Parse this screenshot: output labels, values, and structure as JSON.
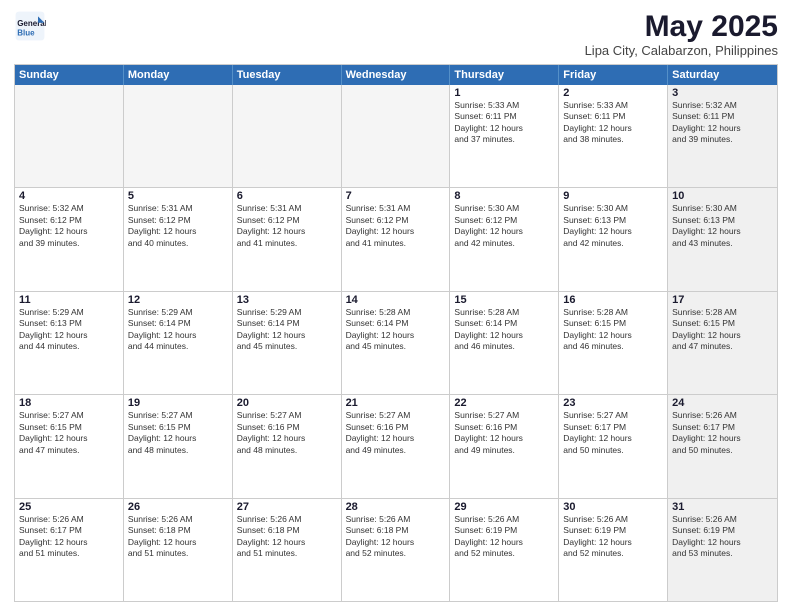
{
  "logo": {
    "line1": "General",
    "line2": "Blue"
  },
  "title": "May 2025",
  "subtitle": "Lipa City, Calabarzon, Philippines",
  "days": [
    "Sunday",
    "Monday",
    "Tuesday",
    "Wednesday",
    "Thursday",
    "Friday",
    "Saturday"
  ],
  "weeks": [
    [
      {
        "day": "",
        "info": "",
        "empty": true
      },
      {
        "day": "",
        "info": "",
        "empty": true
      },
      {
        "day": "",
        "info": "",
        "empty": true
      },
      {
        "day": "",
        "info": "",
        "empty": true
      },
      {
        "day": "1",
        "info": "Sunrise: 5:33 AM\nSunset: 6:11 PM\nDaylight: 12 hours\nand 37 minutes.",
        "empty": false
      },
      {
        "day": "2",
        "info": "Sunrise: 5:33 AM\nSunset: 6:11 PM\nDaylight: 12 hours\nand 38 minutes.",
        "empty": false
      },
      {
        "day": "3",
        "info": "Sunrise: 5:32 AM\nSunset: 6:11 PM\nDaylight: 12 hours\nand 39 minutes.",
        "empty": false,
        "shaded": true
      }
    ],
    [
      {
        "day": "4",
        "info": "Sunrise: 5:32 AM\nSunset: 6:12 PM\nDaylight: 12 hours\nand 39 minutes.",
        "empty": false
      },
      {
        "day": "5",
        "info": "Sunrise: 5:31 AM\nSunset: 6:12 PM\nDaylight: 12 hours\nand 40 minutes.",
        "empty": false
      },
      {
        "day": "6",
        "info": "Sunrise: 5:31 AM\nSunset: 6:12 PM\nDaylight: 12 hours\nand 41 minutes.",
        "empty": false
      },
      {
        "day": "7",
        "info": "Sunrise: 5:31 AM\nSunset: 6:12 PM\nDaylight: 12 hours\nand 41 minutes.",
        "empty": false
      },
      {
        "day": "8",
        "info": "Sunrise: 5:30 AM\nSunset: 6:12 PM\nDaylight: 12 hours\nand 42 minutes.",
        "empty": false
      },
      {
        "day": "9",
        "info": "Sunrise: 5:30 AM\nSunset: 6:13 PM\nDaylight: 12 hours\nand 42 minutes.",
        "empty": false
      },
      {
        "day": "10",
        "info": "Sunrise: 5:30 AM\nSunset: 6:13 PM\nDaylight: 12 hours\nand 43 minutes.",
        "empty": false,
        "shaded": true
      }
    ],
    [
      {
        "day": "11",
        "info": "Sunrise: 5:29 AM\nSunset: 6:13 PM\nDaylight: 12 hours\nand 44 minutes.",
        "empty": false
      },
      {
        "day": "12",
        "info": "Sunrise: 5:29 AM\nSunset: 6:14 PM\nDaylight: 12 hours\nand 44 minutes.",
        "empty": false
      },
      {
        "day": "13",
        "info": "Sunrise: 5:29 AM\nSunset: 6:14 PM\nDaylight: 12 hours\nand 45 minutes.",
        "empty": false
      },
      {
        "day": "14",
        "info": "Sunrise: 5:28 AM\nSunset: 6:14 PM\nDaylight: 12 hours\nand 45 minutes.",
        "empty": false
      },
      {
        "day": "15",
        "info": "Sunrise: 5:28 AM\nSunset: 6:14 PM\nDaylight: 12 hours\nand 46 minutes.",
        "empty": false
      },
      {
        "day": "16",
        "info": "Sunrise: 5:28 AM\nSunset: 6:15 PM\nDaylight: 12 hours\nand 46 minutes.",
        "empty": false
      },
      {
        "day": "17",
        "info": "Sunrise: 5:28 AM\nSunset: 6:15 PM\nDaylight: 12 hours\nand 47 minutes.",
        "empty": false,
        "shaded": true
      }
    ],
    [
      {
        "day": "18",
        "info": "Sunrise: 5:27 AM\nSunset: 6:15 PM\nDaylight: 12 hours\nand 47 minutes.",
        "empty": false
      },
      {
        "day": "19",
        "info": "Sunrise: 5:27 AM\nSunset: 6:15 PM\nDaylight: 12 hours\nand 48 minutes.",
        "empty": false
      },
      {
        "day": "20",
        "info": "Sunrise: 5:27 AM\nSunset: 6:16 PM\nDaylight: 12 hours\nand 48 minutes.",
        "empty": false
      },
      {
        "day": "21",
        "info": "Sunrise: 5:27 AM\nSunset: 6:16 PM\nDaylight: 12 hours\nand 49 minutes.",
        "empty": false
      },
      {
        "day": "22",
        "info": "Sunrise: 5:27 AM\nSunset: 6:16 PM\nDaylight: 12 hours\nand 49 minutes.",
        "empty": false
      },
      {
        "day": "23",
        "info": "Sunrise: 5:27 AM\nSunset: 6:17 PM\nDaylight: 12 hours\nand 50 minutes.",
        "empty": false
      },
      {
        "day": "24",
        "info": "Sunrise: 5:26 AM\nSunset: 6:17 PM\nDaylight: 12 hours\nand 50 minutes.",
        "empty": false,
        "shaded": true
      }
    ],
    [
      {
        "day": "25",
        "info": "Sunrise: 5:26 AM\nSunset: 6:17 PM\nDaylight: 12 hours\nand 51 minutes.",
        "empty": false
      },
      {
        "day": "26",
        "info": "Sunrise: 5:26 AM\nSunset: 6:18 PM\nDaylight: 12 hours\nand 51 minutes.",
        "empty": false
      },
      {
        "day": "27",
        "info": "Sunrise: 5:26 AM\nSunset: 6:18 PM\nDaylight: 12 hours\nand 51 minutes.",
        "empty": false
      },
      {
        "day": "28",
        "info": "Sunrise: 5:26 AM\nSunset: 6:18 PM\nDaylight: 12 hours\nand 52 minutes.",
        "empty": false
      },
      {
        "day": "29",
        "info": "Sunrise: 5:26 AM\nSunset: 6:19 PM\nDaylight: 12 hours\nand 52 minutes.",
        "empty": false
      },
      {
        "day": "30",
        "info": "Sunrise: 5:26 AM\nSunset: 6:19 PM\nDaylight: 12 hours\nand 52 minutes.",
        "empty": false
      },
      {
        "day": "31",
        "info": "Sunrise: 5:26 AM\nSunset: 6:19 PM\nDaylight: 12 hours\nand 53 minutes.",
        "empty": false,
        "shaded": true
      }
    ]
  ]
}
